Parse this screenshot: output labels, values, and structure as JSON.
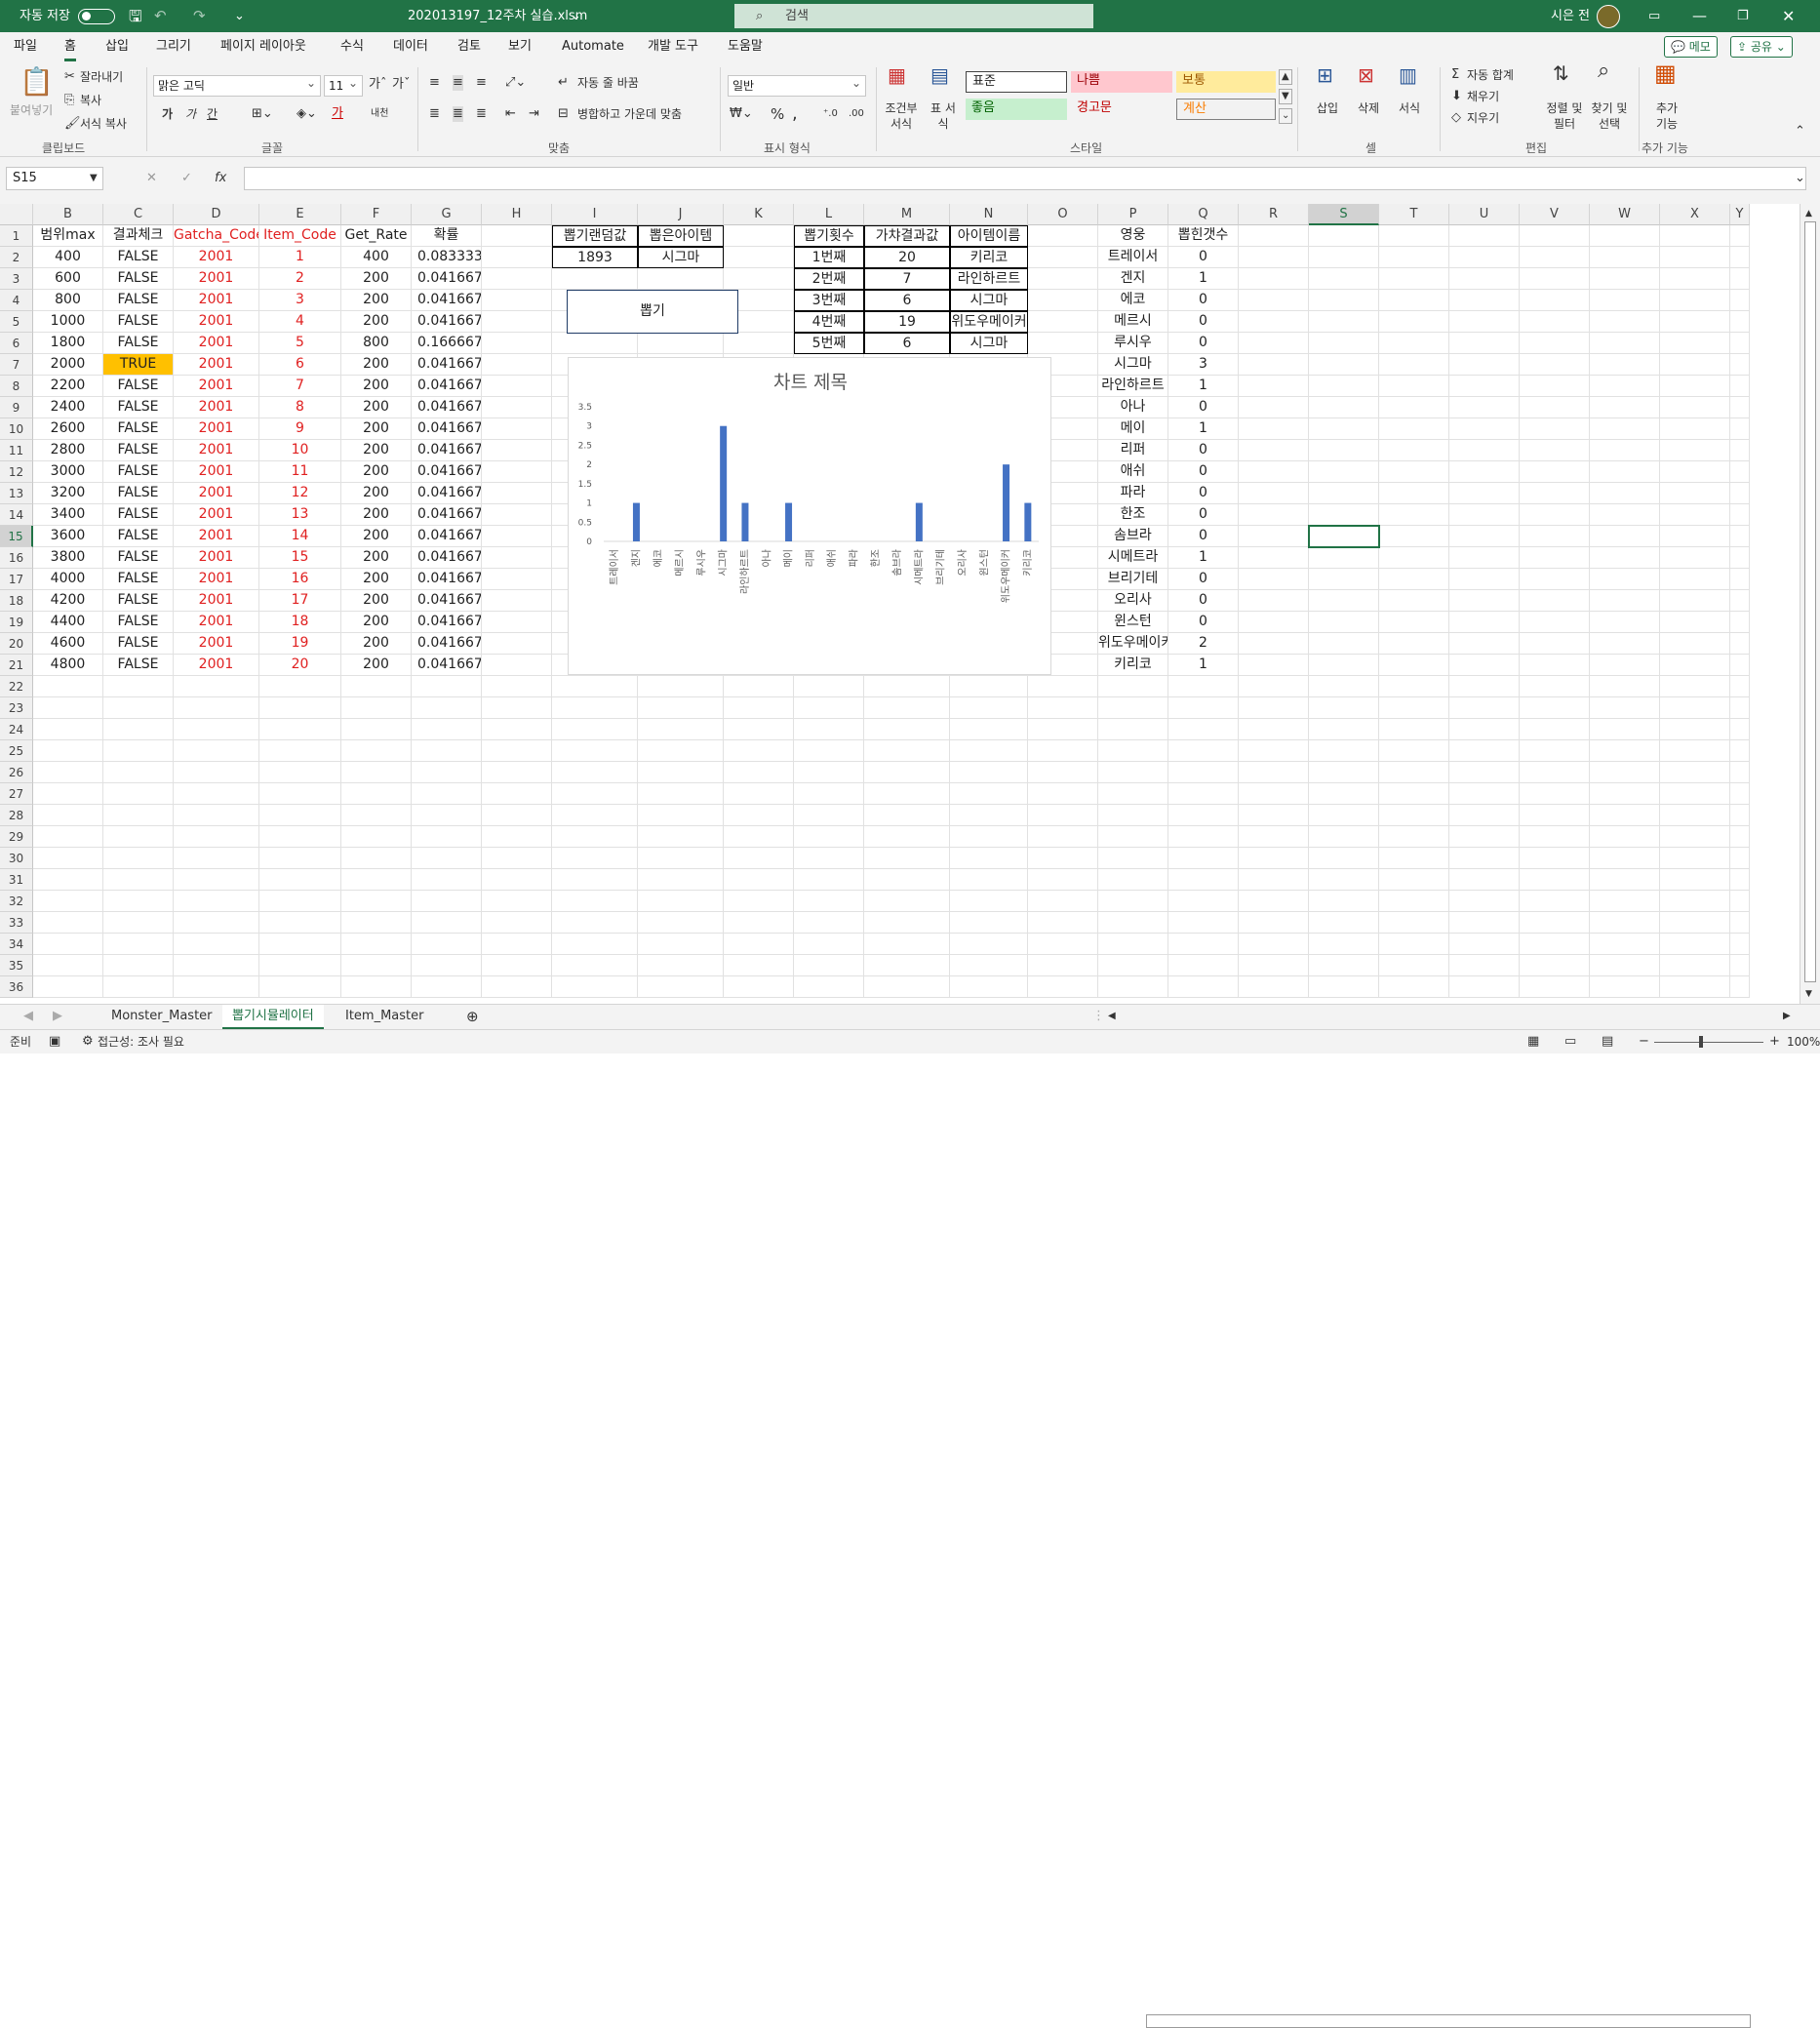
{
  "titlebar": {
    "autosave_label": "자동 저장",
    "autosave_state": "끔",
    "filename": "202013197_12주차 실습.xlsm",
    "search_placeholder": "검색",
    "user_name": "시은 전"
  },
  "menu": {
    "items": [
      "파일",
      "홈",
      "삽입",
      "그리기",
      "페이지 레이아웃",
      "수식",
      "데이터",
      "검토",
      "보기",
      "Automate",
      "개발 도구",
      "도움말"
    ],
    "active": "홈",
    "memo_label": "메모",
    "share_label": "공유"
  },
  "ribbon": {
    "clipboard": {
      "paste": "붙여넣기",
      "cut": "잘라내기",
      "copy": "복사",
      "format_painter": "서식 복사",
      "group": "클립보드"
    },
    "font": {
      "name": "맑은 고딕",
      "size": "11",
      "group": "글꼴",
      "bold": "가",
      "italic": "가",
      "underline": "간"
    },
    "align": {
      "wrap": "자동 줄 바꿈",
      "merge": "병합하고 가운데 맞춤",
      "group": "맞춤"
    },
    "number": {
      "format": "일반",
      "group": "표시 형식"
    },
    "styles": {
      "conditional": "조건부 서식",
      "table": "표 서식",
      "normal": "표준",
      "bad": "나쁨",
      "neutral": "보통",
      "good": "좋음",
      "warning": "경고문",
      "calc": "계산",
      "group": "스타일"
    },
    "cells": {
      "insert": "삽입",
      "delete": "삭제",
      "format": "서식",
      "group": "셀"
    },
    "editing": {
      "autosum": "자동 합계",
      "fill": "채우기",
      "clear": "지우기",
      "sort": "정렬 및 필터",
      "find": "찾기 및 선택",
      "group": "편집"
    },
    "addins": {
      "label": "추가 기능",
      "group": "추가 기능"
    }
  },
  "formula": {
    "namebox": "S15",
    "content": ""
  },
  "columns": [
    "B",
    "C",
    "D",
    "E",
    "F",
    "G",
    "H",
    "I",
    "J",
    "K",
    "L",
    "M",
    "N",
    "O",
    "P",
    "Q",
    "R",
    "S",
    "T",
    "U",
    "V",
    "W",
    "X",
    "Y"
  ],
  "left_table": {
    "headers": [
      "범위max",
      "결과체크",
      "Gatcha_Code",
      "Item_Code",
      "Get_Rate",
      "확률"
    ],
    "rows": [
      [
        "400",
        "FALSE",
        "2001",
        "1",
        "400",
        "0.083333"
      ],
      [
        "600",
        "FALSE",
        "2001",
        "2",
        "200",
        "0.041667"
      ],
      [
        "800",
        "FALSE",
        "2001",
        "3",
        "200",
        "0.041667"
      ],
      [
        "1000",
        "FALSE",
        "2001",
        "4",
        "200",
        "0.041667"
      ],
      [
        "1800",
        "FALSE",
        "2001",
        "5",
        "800",
        "0.166667"
      ],
      [
        "2000",
        "TRUE",
        "2001",
        "6",
        "200",
        "0.041667"
      ],
      [
        "2200",
        "FALSE",
        "2001",
        "7",
        "200",
        "0.041667"
      ],
      [
        "2400",
        "FALSE",
        "2001",
        "8",
        "200",
        "0.041667"
      ],
      [
        "2600",
        "FALSE",
        "2001",
        "9",
        "200",
        "0.041667"
      ],
      [
        "2800",
        "FALSE",
        "2001",
        "10",
        "200",
        "0.041667"
      ],
      [
        "3000",
        "FALSE",
        "2001",
        "11",
        "200",
        "0.041667"
      ],
      [
        "3200",
        "FALSE",
        "2001",
        "12",
        "200",
        "0.041667"
      ],
      [
        "3400",
        "FALSE",
        "2001",
        "13",
        "200",
        "0.041667"
      ],
      [
        "3600",
        "FALSE",
        "2001",
        "14",
        "200",
        "0.041667"
      ],
      [
        "3800",
        "FALSE",
        "2001",
        "15",
        "200",
        "0.041667"
      ],
      [
        "4000",
        "FALSE",
        "2001",
        "16",
        "200",
        "0.041667"
      ],
      [
        "4200",
        "FALSE",
        "2001",
        "17",
        "200",
        "0.041667"
      ],
      [
        "4400",
        "FALSE",
        "2001",
        "18",
        "200",
        "0.041667"
      ],
      [
        "4600",
        "FALSE",
        "2001",
        "19",
        "200",
        "0.041667"
      ],
      [
        "4800",
        "FALSE",
        "2001",
        "20",
        "200",
        "0.041667"
      ]
    ]
  },
  "draw_box": {
    "headers": [
      "뽑기랜덤값",
      "뽑은아이템"
    ],
    "values": [
      "1893",
      "시그마"
    ],
    "button": "뽑기"
  },
  "draw_log": {
    "headers": [
      "뽑기횟수",
      "가챠결과값",
      "아이템이름"
    ],
    "rows": [
      [
        "1번째",
        "20",
        "키리코"
      ],
      [
        "2번째",
        "7",
        "라인하르트"
      ],
      [
        "3번째",
        "6",
        "시그마"
      ],
      [
        "4번째",
        "19",
        "위도우메이커"
      ],
      [
        "5번째",
        "6",
        "시그마"
      ]
    ]
  },
  "hero_table": {
    "headers": [
      "영웅",
      "뽑힌갯수"
    ],
    "rows": [
      [
        "트레이서",
        "0"
      ],
      [
        "겐지",
        "1"
      ],
      [
        "에코",
        "0"
      ],
      [
        "메르시",
        "0"
      ],
      [
        "루시우",
        "0"
      ],
      [
        "시그마",
        "3"
      ],
      [
        "라인하르트",
        "1"
      ],
      [
        "아나",
        "0"
      ],
      [
        "메이",
        "1"
      ],
      [
        "리퍼",
        "0"
      ],
      [
        "애쉬",
        "0"
      ],
      [
        "파라",
        "0"
      ],
      [
        "한조",
        "0"
      ],
      [
        "솜브라",
        "0"
      ],
      [
        "시메트라",
        "1"
      ],
      [
        "브리기테",
        "0"
      ],
      [
        "오리사",
        "0"
      ],
      [
        "윈스턴",
        "0"
      ],
      [
        "위도우메이커",
        "2"
      ],
      [
        "키리코",
        "1"
      ]
    ]
  },
  "chart_data": {
    "type": "bar",
    "title": "차트 제목",
    "categories": [
      "트레이서",
      "겐지",
      "에코",
      "메르시",
      "루시우",
      "시그마",
      "라인하르트",
      "아나",
      "메이",
      "리퍼",
      "애쉬",
      "파라",
      "한조",
      "솜브라",
      "시메트라",
      "브리기테",
      "오리사",
      "윈스턴",
      "위도우메이커",
      "키리코"
    ],
    "values": [
      0,
      1,
      0,
      0,
      0,
      3,
      1,
      0,
      1,
      0,
      0,
      0,
      0,
      0,
      1,
      0,
      0,
      0,
      2,
      1
    ],
    "yticks": [
      "0",
      "0.5",
      "1",
      "1.5",
      "2",
      "2.5",
      "3",
      "3.5"
    ],
    "ylim": [
      0,
      3.5
    ],
    "color": "#4472c4"
  },
  "sheets": {
    "tabs": [
      "Monster_Master",
      "뽑기시뮬레이터",
      "Item_Master"
    ],
    "active": "뽑기시뮬레이터"
  },
  "status": {
    "ready": "준비",
    "accessibility": "접근성: 조사 필요",
    "zoom": "100%"
  },
  "colors": {
    "accent": "#217346",
    "true_fill": "#ffc000",
    "red_text": "#e02020"
  }
}
